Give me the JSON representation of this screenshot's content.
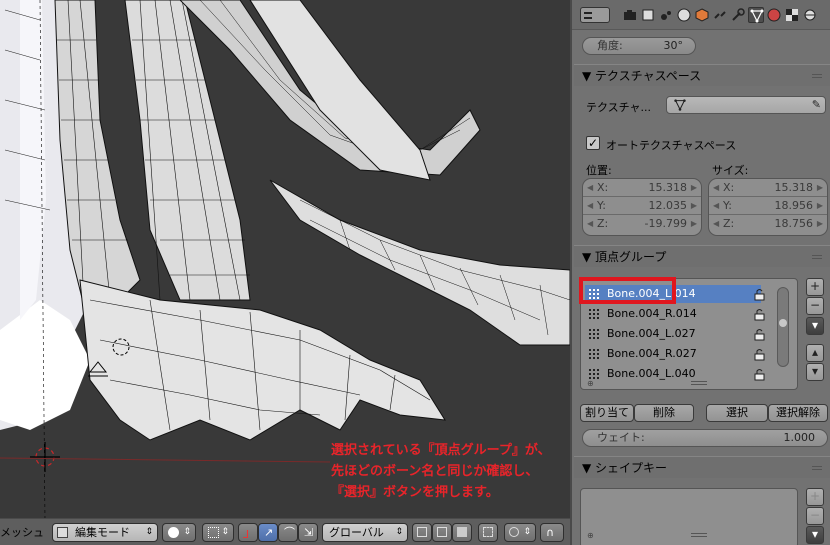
{
  "viewport": {
    "annotation_lines": [
      "選択されている『頂点グループ』が、",
      "先ほどのボーン名と同じか確認し、",
      "『選択』ボタンを押します。"
    ],
    "header": {
      "mesh_label": "メッシュ",
      "mode_label": "編集モード",
      "orientation_label": "グローバル"
    }
  },
  "properties": {
    "angle": {
      "label": "角度:",
      "value": "30°"
    },
    "texture_space": {
      "title": "テクスチャスペース",
      "texture_label": "テクスチャ...",
      "auto_checkbox_label": "オートテクスチャスペース",
      "auto_checked": true,
      "location_label": "位置:",
      "size_label": "サイズ:",
      "location": [
        {
          "axis": "X:",
          "value": "15.318"
        },
        {
          "axis": "Y:",
          "value": "12.035"
        },
        {
          "axis": "Z:",
          "value": "-19.799"
        }
      ],
      "size": [
        {
          "axis": "X:",
          "value": "15.318"
        },
        {
          "axis": "Y:",
          "value": "18.956"
        },
        {
          "axis": "Z:",
          "value": "18.756"
        }
      ]
    },
    "vertex_groups": {
      "title": "頂点グループ",
      "items": [
        {
          "name": "Bone.004_L.014",
          "active": true
        },
        {
          "name": "Bone.004_R.014",
          "active": false
        },
        {
          "name": "Bone.004_L.027",
          "active": false
        },
        {
          "name": "Bone.004_R.027",
          "active": false
        },
        {
          "name": "Bone.004_L.040",
          "active": false
        }
      ],
      "assign_label": "割り当て",
      "remove_label": "削除",
      "select_label": "選択",
      "deselect_label": "選択解除",
      "weight_label": "ウェイト:",
      "weight_value": "1.000"
    },
    "shape_keys": {
      "title": "シェイプキー"
    }
  },
  "colors": {
    "highlight": "#e0161e",
    "annotation": "#e8242a",
    "selected_row": "#5680c2"
  }
}
